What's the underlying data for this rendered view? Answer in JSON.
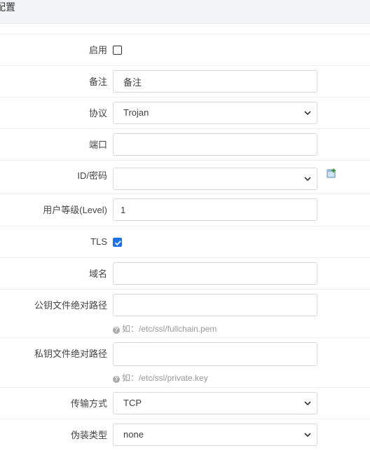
{
  "header": {
    "title": "配置"
  },
  "form": {
    "enable": {
      "label": "启用",
      "checked": false
    },
    "remark": {
      "label": "备注",
      "value": "备注"
    },
    "protocol": {
      "label": "协议",
      "value": "Trojan"
    },
    "port": {
      "label": "端口",
      "value": ""
    },
    "id_password": {
      "label": "ID/密码",
      "value": ""
    },
    "level": {
      "label": "用户等级(Level)",
      "value": "1"
    },
    "tls": {
      "label": "TLS",
      "checked": true
    },
    "domain": {
      "label": "域名",
      "value": ""
    },
    "cert_path": {
      "label": "公钥文件绝对路径",
      "value": "",
      "hint": "如：/etc/ssl/fullchain.pem"
    },
    "key_path": {
      "label": "私钥文件绝对路径",
      "value": "",
      "hint": "如：/etc/ssl/private.key"
    },
    "transport": {
      "label": "传输方式",
      "value": "TCP"
    },
    "header_type": {
      "label": "伪装类型",
      "value": "none"
    }
  },
  "icons": {
    "hint": "question-circle-icon",
    "add": "add-item-icon",
    "chevron": "chevron-down-icon"
  }
}
